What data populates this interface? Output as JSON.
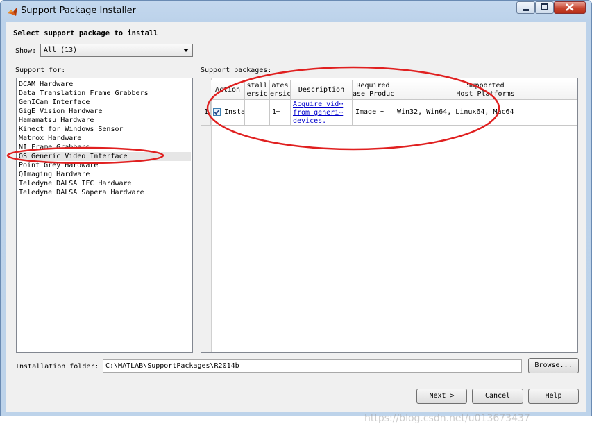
{
  "window": {
    "title": "Support Package Installer"
  },
  "heading": "Select support package to install",
  "show": {
    "label": "Show:",
    "value": "All (13)"
  },
  "support_for": {
    "label": "Support for:",
    "items": [
      "DCAM Hardware",
      "Data Translation Frame Grabbers",
      "GenICam Interface",
      "GigE Vision Hardware",
      "Hamamatsu Hardware",
      "Kinect for Windows Sensor",
      "Matrox Hardware",
      "NI Frame Grabbers",
      "OS Generic Video Interface",
      "Point Grey Hardware",
      "QImaging Hardware",
      "Teledyne DALSA IFC Hardware",
      "Teledyne DALSA Sapera Hardware"
    ],
    "selected_index": 8
  },
  "packages": {
    "label": "Support packages:",
    "columns": [
      [
        "Action"
      ],
      [
        "stall",
        "ersic"
      ],
      [
        "ates",
        "ersic"
      ],
      [
        "Description"
      ],
      [
        "Required",
        "ase Produc"
      ],
      [
        "Supported",
        "Host Platforms"
      ]
    ],
    "row": {
      "index": "1",
      "action": "Insta",
      "checked": true,
      "installed": "",
      "latest": "1⋯",
      "description": [
        "Acquire vid⋯",
        "from generi⋯",
        "devices."
      ],
      "required": "Image ⋯",
      "platforms": "Win32, Win64, Linux64, Mac64"
    }
  },
  "folder": {
    "label": "Installation folder:",
    "value": "C:\\MATLAB\\SupportPackages\\R2014b"
  },
  "buttons": {
    "browse": "Browse...",
    "next": "Next >",
    "cancel": "Cancel",
    "help": "Help"
  },
  "watermark": "https://blog.csdn.net/u013673437",
  "colors": {
    "annotation": "#e02020",
    "link": "#0000cc"
  }
}
